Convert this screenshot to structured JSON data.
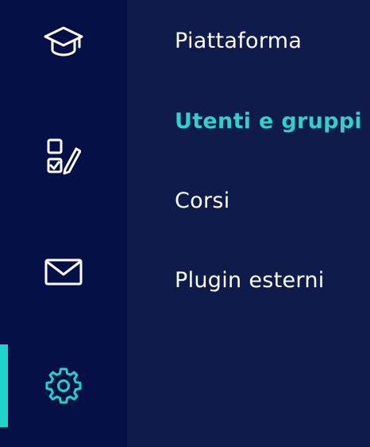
{
  "colors": {
    "rail_background": "#051047",
    "panel_background": "#0f1b4a",
    "accent": "#1fd4cc",
    "text": "#ffffff"
  },
  "rail": {
    "items": [
      {
        "icon": "graduation-cap-icon"
      },
      {
        "icon": "checklist-edit-icon"
      },
      {
        "icon": "envelope-icon"
      },
      {
        "icon": "gear-icon",
        "active": true
      }
    ]
  },
  "menu": {
    "items": [
      {
        "label": "Piattaforma",
        "active": false
      },
      {
        "label": "Utenti e gruppi",
        "active": true
      },
      {
        "label": "Corsi",
        "active": false
      },
      {
        "label": "Plugin esterni",
        "active": false
      }
    ]
  }
}
